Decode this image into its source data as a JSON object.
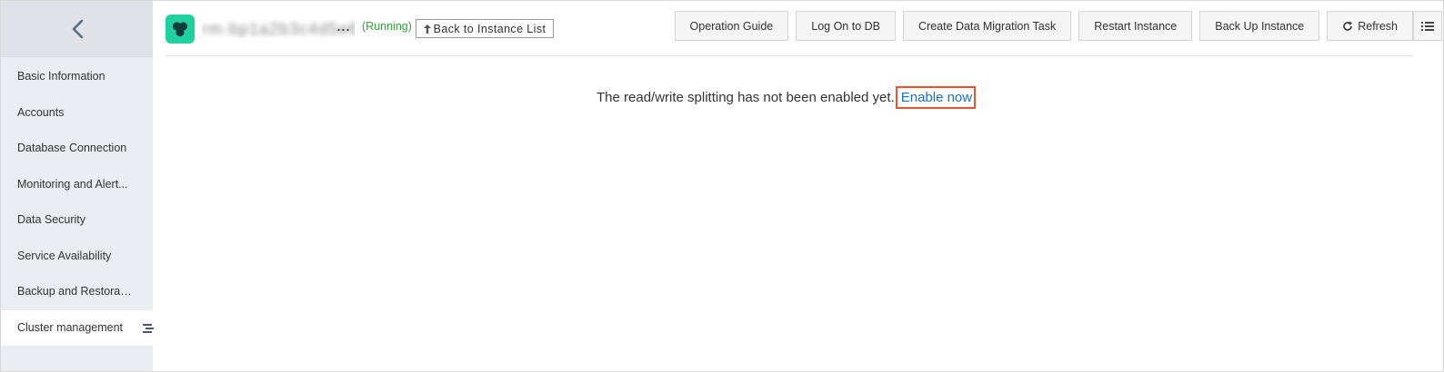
{
  "sidebar": {
    "items": [
      {
        "label": "Basic Information"
      },
      {
        "label": "Accounts"
      },
      {
        "label": "Database Connection"
      },
      {
        "label": "Monitoring and Alert..."
      },
      {
        "label": "Data Security"
      },
      {
        "label": "Service Availability"
      },
      {
        "label": "Backup and Restorati..."
      },
      {
        "label": "Cluster management"
      }
    ],
    "active_index": 7
  },
  "header": {
    "instance_name": "rm-bp1a2b3c4d5e6f",
    "ellipsis": "...",
    "status": "(Running)",
    "back_label": "Back to Instance List"
  },
  "toolbar": {
    "buttons": [
      {
        "label": "Operation Guide"
      },
      {
        "label": "Log On to DB"
      },
      {
        "label": "Create Data Migration Task"
      },
      {
        "label": "Restart Instance"
      },
      {
        "label": "Back Up Instance"
      },
      {
        "label": "Refresh"
      }
    ]
  },
  "main": {
    "message": "The read/write splitting has not been enabled yet.",
    "enable_link": "Enable now"
  },
  "colors": {
    "logo_bg": "#1fd1a0",
    "status_green": "#2aa834",
    "link_blue": "#1a6fd1",
    "highlight_box": "#e8542f",
    "sidebar_bg": "#eaedf1"
  }
}
